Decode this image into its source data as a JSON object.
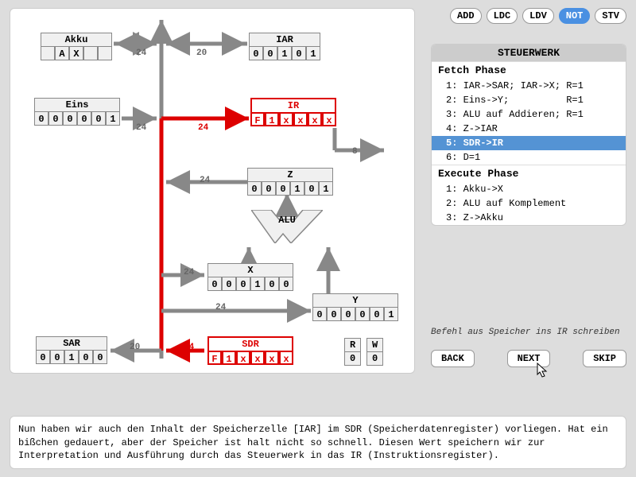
{
  "toolbar": {
    "buttons": [
      "ADD",
      "LDC",
      "LDV",
      "NOT",
      "STV"
    ],
    "active": 3
  },
  "registers": {
    "akku": {
      "title": "Akku",
      "cells": [
        " ",
        "A",
        "X",
        " ",
        " "
      ]
    },
    "iar": {
      "title": "IAR",
      "cells": [
        "0",
        "0",
        "1",
        "0",
        "1"
      ]
    },
    "eins": {
      "title": "Eins",
      "cells": [
        "0",
        "0",
        "0",
        "0",
        "0",
        "1"
      ]
    },
    "ir": {
      "title": "IR",
      "cells": [
        "F",
        "1",
        "x",
        "x",
        "x",
        "x"
      ]
    },
    "z": {
      "title": "Z",
      "cells": [
        "0",
        "0",
        "0",
        "1",
        "0",
        "1"
      ]
    },
    "x": {
      "title": "X",
      "cells": [
        "0",
        "0",
        "0",
        "1",
        "0",
        "0"
      ]
    },
    "y": {
      "title": "Y",
      "cells": [
        "0",
        "0",
        "0",
        "0",
        "0",
        "1"
      ]
    },
    "sar": {
      "title": "SAR",
      "cells": [
        "0",
        "0",
        "1",
        "0",
        "0"
      ]
    },
    "sdr": {
      "title": "SDR",
      "cells": [
        "F",
        "1",
        "x",
        "x",
        "x",
        "x"
      ]
    },
    "r": {
      "label": "R",
      "val": "0"
    },
    "w": {
      "label": "W",
      "val": "0"
    }
  },
  "alu": {
    "label": "ALU"
  },
  "bus": {
    "w24": "24",
    "w20": "20",
    "w8": "8"
  },
  "steuerwerk": {
    "title": "STEUERWERK",
    "fetch_title": "Fetch Phase",
    "fetch": [
      "1: IAR->SAR; IAR->X; R=1",
      "2: Eins->Y;          R=1",
      "3: ALU auf Addieren; R=1",
      "4: Z->IAR",
      "5: SDR->IR",
      "6: D=1"
    ],
    "fetch_active": 4,
    "exec_title": "Execute Phase",
    "exec": [
      "1: Akku->X",
      "2: ALU auf Komplement",
      "3: Z->Akku"
    ]
  },
  "status": "Befehl aus Speicher ins IR schreiben",
  "nav": {
    "back": "BACK",
    "next": "NEXT",
    "skip": "SKIP"
  },
  "description": "Nun haben wir auch den Inhalt der Speicherzelle [IAR] im SDR (Speicherdatenregister) vorliegen. Hat ein bißchen gedauert, aber der Speicher ist halt nicht so schnell. Diesen Wert speichern wir zur Interpretation und Ausführung durch das Steuerwerk in das IR (Instruktionsregister)."
}
